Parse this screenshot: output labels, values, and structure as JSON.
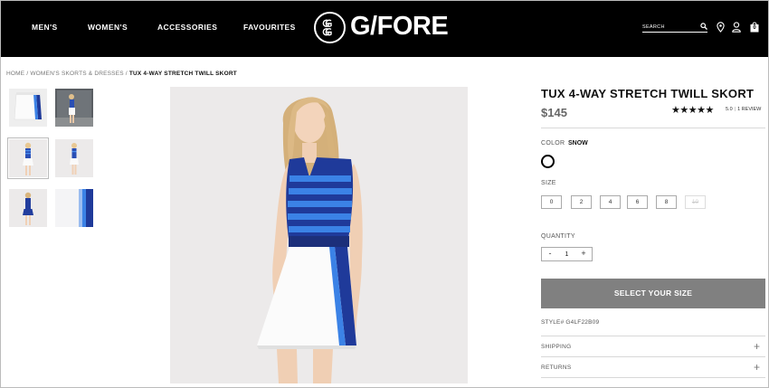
{
  "header": {
    "nav": [
      "MEN'S",
      "WOMEN'S",
      "ACCESSORIES",
      "FAVOURITES"
    ],
    "logo_text": "G/FORE",
    "search_placeholder": "SEARCH",
    "bag_count": "0"
  },
  "breadcrumb": {
    "home": "HOME",
    "sep": " / ",
    "category": "WOMEN'S SKORTS & DRESSES",
    "current": "TUX 4-WAY STRETCH TWILL SKORT"
  },
  "product": {
    "title": "TUX 4-WAY STRETCH TWILL SKORT",
    "price": "$145",
    "stars": "★★★★★",
    "rating_value": "5.0",
    "rating_sep": "|",
    "reviews": "1 REVIEW",
    "color_label": "COLOR",
    "color_value": "SNOW",
    "size_label": "SIZE",
    "sizes": [
      "0",
      "2",
      "4",
      "6",
      "8",
      "10"
    ],
    "unavailable_size": "10",
    "quantity_label": "QUANTITY",
    "quantity_minus": "-",
    "quantity_value": "1",
    "quantity_plus": "+",
    "cta_label": "SELECT YOUR SIZE",
    "style_number": "STYLE# G4LF22B09",
    "accordions": [
      {
        "label": "SHIPPING",
        "icon": "+"
      },
      {
        "label": "RETURNS",
        "icon": "+"
      }
    ]
  },
  "colors": {
    "header_bg": "#000000",
    "cta_bg": "#808080",
    "price": "#666666",
    "top_stripe_dark": "#1f3a9a",
    "top_stripe_light": "#3b82e6"
  }
}
